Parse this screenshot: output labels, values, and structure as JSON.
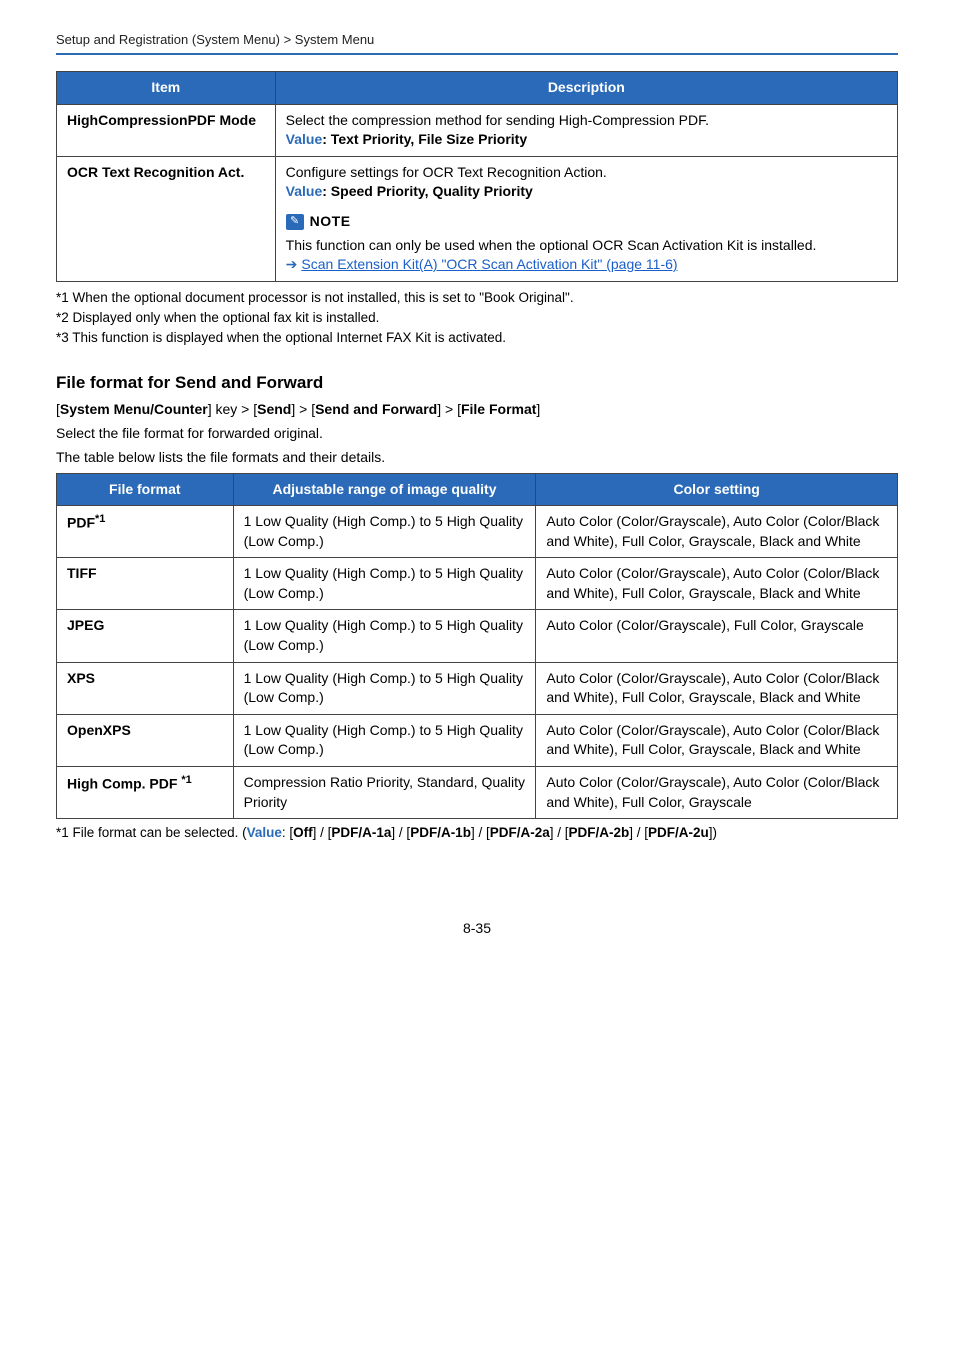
{
  "breadcrumb": "Setup and Registration (System Menu) > System Menu",
  "table1": {
    "headers": [
      "Item",
      "Description"
    ],
    "rows": [
      {
        "item": "HighCompressionPDF Mode",
        "item_name": "high-compression-pdf-mode",
        "desc_html": "Select the compression method for sending High-Compression PDF.<br><span class=\"blue-label\">Value</span><span class=\"value-black\">: Text Priority, File Size Priority</span>"
      },
      {
        "item": "OCR Text Recognition Act.",
        "item_name": "ocr-text-recognition-act",
        "desc_html": "Configure settings for OCR Text Recognition Action.<br><span class=\"blue-label\">Value</span><span class=\"value-black\">: Speed Priority, Quality Priority</span><div class=\"note-row\"><span class=\"note-icon\" data-name=\"note-icon\" data-interactable=\"false\">✎</span><span class=\"note-label\" data-name=\"note-label\" data-interactable=\"false\">NOTE</span></div>This function can only be used when the optional OCR Scan Activation Kit is installed.<br><span class=\"arrow\" data-name=\"link-arrow-icon\" data-interactable=\"false\">➔</span><a class=\"link\" data-name=\"scan-extension-kit-link\" data-interactable=\"true\">Scan Extension Kit(A) \"OCR Scan Activation Kit\" (page 11-6)</a>"
      }
    ]
  },
  "footnotes1": [
    "*1  When the optional document processor is not installed, this is set to \"Book Original\".",
    "*2  Displayed only when the optional fax kit is installed.",
    "*3  This function is displayed when the optional Internet FAX Kit is activated."
  ],
  "section_title": "File format for Send and Forward",
  "sub_path_html": "[<b>System Menu/Counter</b>] key > [<b>Send</b>] > [<b>Send and Forward</b>] > [<b>File Format</b>]",
  "para1": "Select the file format for forwarded original.",
  "para2": "The table below lists the file formats and their details.",
  "table2": {
    "headers": [
      "File format",
      "Adjustable range of image quality",
      "Color setting"
    ],
    "rows": [
      {
        "format_html": "PDF<span class=\"sup\">*1</span>",
        "format_name": "format-pdf",
        "range": "1 Low Quality (High Comp.) to 5 High Quality (Low Comp.)",
        "color": "Auto Color (Color/Grayscale), Auto Color (Color/Black and White), Full Color, Grayscale, Black and White"
      },
      {
        "format_html": "TIFF",
        "format_name": "format-tiff",
        "range": "1 Low Quality (High Comp.) to 5 High Quality (Low Comp.)",
        "color": "Auto Color (Color/Grayscale), Auto Color (Color/Black and White), Full Color, Grayscale, Black and White"
      },
      {
        "format_html": "JPEG",
        "format_name": "format-jpeg",
        "range": "1 Low Quality (High Comp.) to 5 High Quality (Low Comp.)",
        "color": "Auto Color (Color/Grayscale), Full Color, Grayscale"
      },
      {
        "format_html": "XPS",
        "format_name": "format-xps",
        "range": "1 Low Quality (High Comp.) to 5 High Quality (Low Comp.)",
        "color": "Auto Color (Color/Grayscale), Auto Color (Color/Black and White), Full Color, Grayscale, Black and White"
      },
      {
        "format_html": "OpenXPS",
        "format_name": "format-openxps",
        "range": "1 Low Quality (High Comp.) to 5 High Quality (Low Comp.)",
        "color": "Auto Color (Color/Grayscale), Auto Color (Color/Black and White), Full Color, Grayscale, Black and White"
      },
      {
        "format_html": "High Comp. PDF <span class=\"sup\">*1</span>",
        "format_name": "format-high-comp-pdf",
        "range": "Compression Ratio Priority, Standard, Quality Priority",
        "color": "Auto Color (Color/Grayscale), Auto Color (Color/Black and White), Full Color, Grayscale"
      }
    ]
  },
  "footnote2_html": "*1  File format can be selected. (<span class=\"blue-label\">Value</span>: [<b>Off</b>] / [<b>PDF/A-1a</b>] / [<b>PDF/A-1b</b>] / [<b>PDF/A-2a</b>] / [<b>PDF/A-2b</b>] / [<b>PDF/A-2u</b>])",
  "page_number": "8-35"
}
